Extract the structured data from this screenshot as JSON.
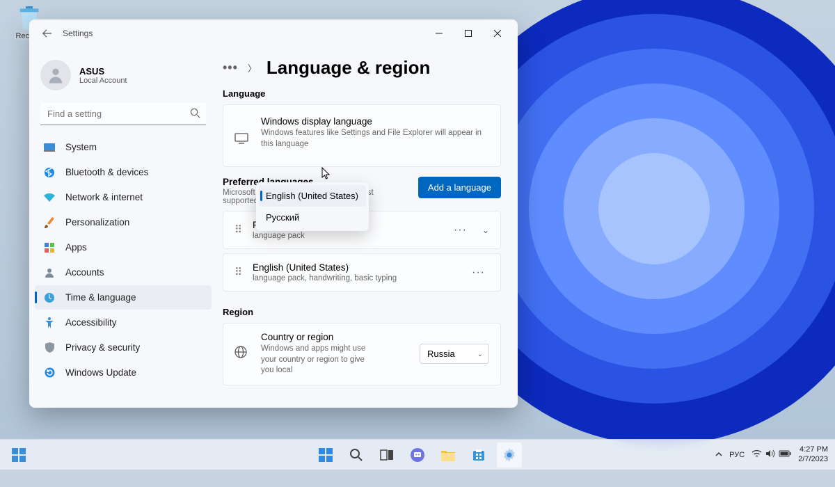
{
  "desktop": {
    "recycle_bin": "Recycle"
  },
  "window": {
    "title": "Settings"
  },
  "account": {
    "name": "ASUS",
    "type": "Local Account"
  },
  "search": {
    "placeholder": "Find a setting"
  },
  "sidebar": {
    "items": [
      {
        "label": "System"
      },
      {
        "label": "Bluetooth & devices"
      },
      {
        "label": "Network & internet"
      },
      {
        "label": "Personalization"
      },
      {
        "label": "Apps"
      },
      {
        "label": "Accounts"
      },
      {
        "label": "Time & language"
      },
      {
        "label": "Accessibility"
      },
      {
        "label": "Privacy & security"
      },
      {
        "label": "Windows Update"
      }
    ]
  },
  "page": {
    "title": "Language & region",
    "section_language": "Language",
    "section_region": "Region",
    "display_lang": {
      "title": "Windows display language",
      "sub": "Windows features like Settings and File Explorer will appear in this language"
    },
    "dropdown": {
      "options": [
        {
          "label": "English (United States)",
          "selected": true
        },
        {
          "label": "Русский",
          "selected": false
        }
      ]
    },
    "preferred": {
      "title": "Preferred languages",
      "sub": "Microsoft Store apps will appear in the first supported language in this list",
      "add_button": "Add a language"
    },
    "langs": [
      {
        "name": "Russian",
        "sub": "language pack"
      },
      {
        "name": "English (United States)",
        "sub": "language pack, handwriting, basic typing"
      }
    ],
    "region": {
      "title": "Country or region",
      "sub": "Windows and apps might use your country or region to give you local",
      "value": "Russia"
    }
  },
  "taskbar": {
    "ime": "РУС",
    "time": "4:27 PM",
    "date": "2/7/2023"
  }
}
